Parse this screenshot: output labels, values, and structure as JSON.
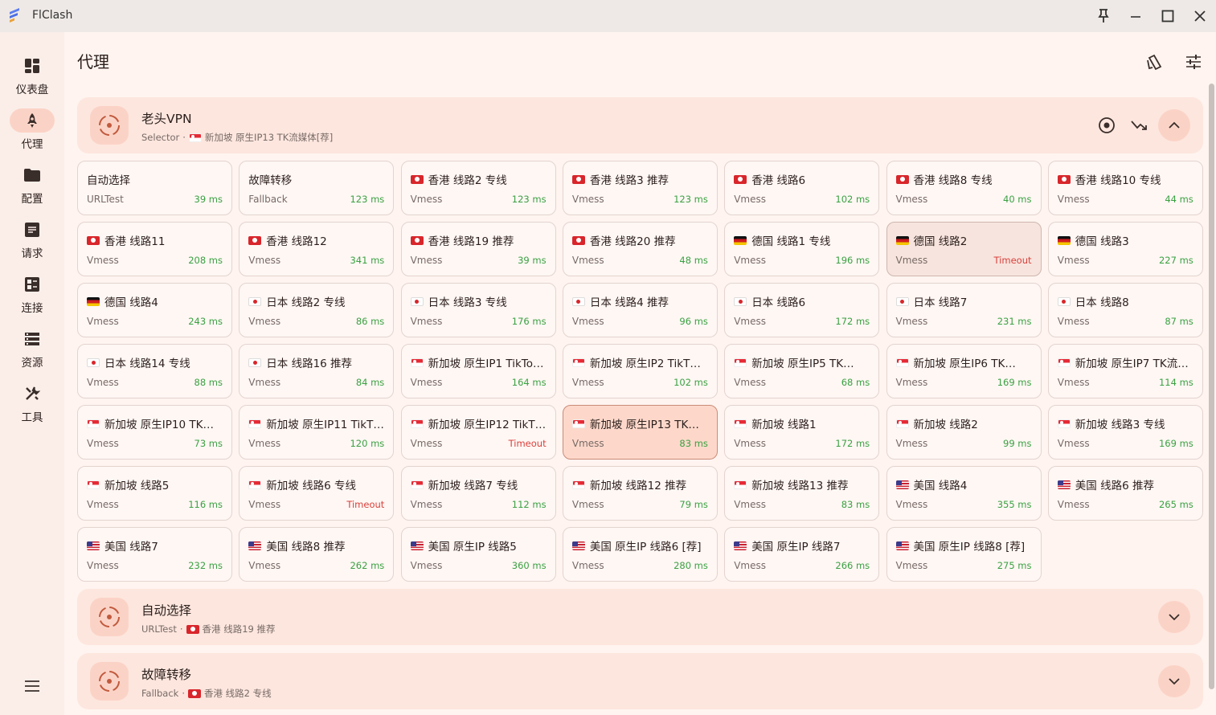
{
  "app": {
    "title": "FlClash"
  },
  "page": {
    "title": "代理"
  },
  "nav": {
    "items": [
      {
        "label": "仪表盘",
        "icon": "dashboard-icon"
      },
      {
        "label": "代理",
        "icon": "rocket-icon"
      },
      {
        "label": "配置",
        "icon": "folder-icon"
      },
      {
        "label": "请求",
        "icon": "request-icon"
      },
      {
        "label": "连接",
        "icon": "connections-icon"
      },
      {
        "label": "资源",
        "icon": "storage-icon"
      },
      {
        "label": "工具",
        "icon": "tools-icon"
      }
    ],
    "active": 1
  },
  "groups": [
    {
      "name": "老头VPN",
      "type": "Selector",
      "sep": "·",
      "flag": "sg",
      "current": "新加坡 原生IP13 TK流媒体[荐]",
      "expanded": true
    },
    {
      "name": "自动选择",
      "type": "URLTest",
      "sep": "·",
      "flag": "hk",
      "current": "香港 线路19 推荐",
      "expanded": false
    },
    {
      "name": "故障转移",
      "type": "Fallback",
      "sep": "·",
      "flag": "hk",
      "current": "香港 线路2 专线",
      "expanded": false
    }
  ],
  "proxies": [
    {
      "name": "自动选择",
      "flag": "",
      "type": "URLTest",
      "delay": "39 ms"
    },
    {
      "name": "故障转移",
      "flag": "",
      "type": "Fallback",
      "delay": "123 ms"
    },
    {
      "name": "香港 线路2 专线",
      "flag": "hk",
      "type": "Vmess",
      "delay": "123 ms"
    },
    {
      "name": "香港 线路3 推荐",
      "flag": "hk",
      "type": "Vmess",
      "delay": "123 ms"
    },
    {
      "name": "香港 线路6",
      "flag": "hk",
      "type": "Vmess",
      "delay": "102 ms"
    },
    {
      "name": "香港 线路8 专线",
      "flag": "hk",
      "type": "Vmess",
      "delay": "40 ms"
    },
    {
      "name": "香港 线路10 专线",
      "flag": "hk",
      "type": "Vmess",
      "delay": "44 ms"
    },
    {
      "name": "香港 线路11",
      "flag": "hk",
      "type": "Vmess",
      "delay": "208 ms"
    },
    {
      "name": "香港 线路12",
      "flag": "hk",
      "type": "Vmess",
      "delay": "341 ms"
    },
    {
      "name": "香港 线路19 推荐",
      "flag": "hk",
      "type": "Vmess",
      "delay": "39 ms"
    },
    {
      "name": "香港 线路20 推荐",
      "flag": "hk",
      "type": "Vmess",
      "delay": "48 ms"
    },
    {
      "name": "德国 线路1 专线",
      "flag": "de",
      "type": "Vmess",
      "delay": "196 ms"
    },
    {
      "name": "德国 线路2",
      "flag": "de",
      "type": "Vmess",
      "delay": "Timeout",
      "state": "hover"
    },
    {
      "name": "德国 线路3",
      "flag": "de",
      "type": "Vmess",
      "delay": "227 ms"
    },
    {
      "name": "德国 线路4",
      "flag": "de",
      "type": "Vmess",
      "delay": "243 ms"
    },
    {
      "name": "日本 线路2 专线",
      "flag": "jp",
      "type": "Vmess",
      "delay": "86 ms"
    },
    {
      "name": "日本 线路3 专线",
      "flag": "jp",
      "type": "Vmess",
      "delay": "176 ms"
    },
    {
      "name": "日本 线路4 推荐",
      "flag": "jp",
      "type": "Vmess",
      "delay": "96 ms"
    },
    {
      "name": "日本 线路6",
      "flag": "jp",
      "type": "Vmess",
      "delay": "172 ms"
    },
    {
      "name": "日本 线路7",
      "flag": "jp",
      "type": "Vmess",
      "delay": "231 ms"
    },
    {
      "name": "日本 线路8",
      "flag": "jp",
      "type": "Vmess",
      "delay": "87 ms"
    },
    {
      "name": "日本 线路14 专线",
      "flag": "jp",
      "type": "Vmess",
      "delay": "88 ms"
    },
    {
      "name": "日本 线路16 推荐",
      "flag": "jp",
      "type": "Vmess",
      "delay": "84 ms"
    },
    {
      "name": "新加坡 原生IP1 TikTo…",
      "flag": "sg",
      "type": "Vmess",
      "delay": "164 ms"
    },
    {
      "name": "新加坡 原生IP2 TikT…",
      "flag": "sg",
      "type": "Vmess",
      "delay": "102 ms"
    },
    {
      "name": "新加坡 原生IP5 TK…",
      "flag": "sg",
      "type": "Vmess",
      "delay": "68 ms"
    },
    {
      "name": "新加坡 原生IP6 TK…",
      "flag": "sg",
      "type": "Vmess",
      "delay": "169 ms"
    },
    {
      "name": "新加坡 原生IP7 TK流…",
      "flag": "sg",
      "type": "Vmess",
      "delay": "114 ms"
    },
    {
      "name": "新加坡 原生IP10 TK…",
      "flag": "sg",
      "type": "Vmess",
      "delay": "73 ms"
    },
    {
      "name": "新加坡 原生IP11 TikT…",
      "flag": "sg",
      "type": "Vmess",
      "delay": "120 ms"
    },
    {
      "name": "新加坡 原生IP12 TikT…",
      "flag": "sg",
      "type": "Vmess",
      "delay": "Timeout"
    },
    {
      "name": "新加坡 原生IP13 TK…",
      "flag": "sg",
      "type": "Vmess",
      "delay": "83 ms",
      "state": "selected"
    },
    {
      "name": "新加坡 线路1",
      "flag": "sg",
      "type": "Vmess",
      "delay": "172 ms"
    },
    {
      "name": "新加坡 线路2",
      "flag": "sg",
      "type": "Vmess",
      "delay": "99 ms"
    },
    {
      "name": "新加坡 线路3 专线",
      "flag": "sg",
      "type": "Vmess",
      "delay": "169 ms"
    },
    {
      "name": "新加坡 线路5",
      "flag": "sg",
      "type": "Vmess",
      "delay": "116 ms"
    },
    {
      "name": "新加坡 线路6 专线",
      "flag": "sg",
      "type": "Vmess",
      "delay": "Timeout"
    },
    {
      "name": "新加坡 线路7 专线",
      "flag": "sg",
      "type": "Vmess",
      "delay": "112 ms"
    },
    {
      "name": "新加坡 线路12 推荐",
      "flag": "sg",
      "type": "Vmess",
      "delay": "79 ms"
    },
    {
      "name": "新加坡 线路13 推荐",
      "flag": "sg",
      "type": "Vmess",
      "delay": "83 ms"
    },
    {
      "name": "美国 线路4",
      "flag": "us",
      "type": "Vmess",
      "delay": "355 ms"
    },
    {
      "name": "美国 线路6 推荐",
      "flag": "us",
      "type": "Vmess",
      "delay": "265 ms"
    },
    {
      "name": "美国 线路7",
      "flag": "us",
      "type": "Vmess",
      "delay": "232 ms"
    },
    {
      "name": "美国 线路8 推荐",
      "flag": "us",
      "type": "Vmess",
      "delay": "262 ms"
    },
    {
      "name": "美国 原生IP 线路5",
      "flag": "us",
      "type": "Vmess",
      "delay": "360 ms"
    },
    {
      "name": "美国 原生IP 线路6 [荐]",
      "flag": "us",
      "type": "Vmess",
      "delay": "280 ms"
    },
    {
      "name": "美国 原生IP 线路7",
      "flag": "us",
      "type": "Vmess",
      "delay": "266 ms"
    },
    {
      "name": "美国 原生IP 线路8 [荐]",
      "flag": "us",
      "type": "Vmess",
      "delay": "275 ms"
    }
  ],
  "colors": {
    "accent": "#c15a3e",
    "delay_ok": "#3aa142",
    "delay_timeout": "#d9413c",
    "background": "#fff4f0"
  }
}
